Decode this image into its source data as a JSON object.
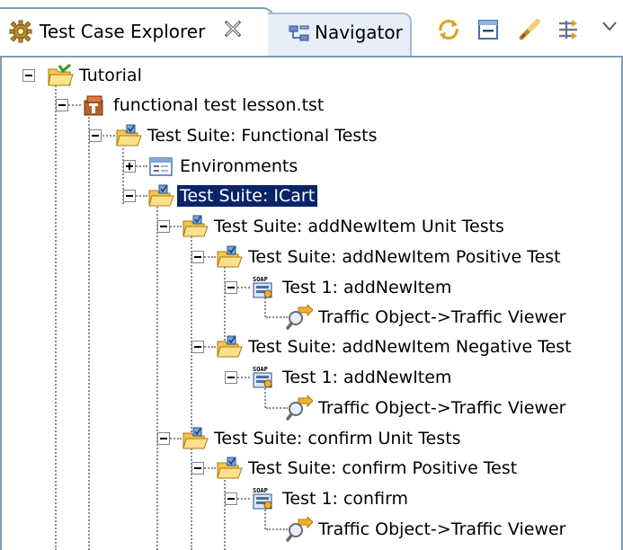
{
  "tabs": {
    "active_label": "Test Case Explorer",
    "inactive_label": "Navigator"
  },
  "toolbar": {
    "buttons": [
      "sync-icon",
      "collapse-all-icon",
      "link-editor-icon",
      "filter-icon"
    ],
    "view_menu": "chevron-down-icon"
  },
  "tree": {
    "nodes": [
      {
        "label": "Tutorial",
        "icon": "project-folder-icon",
        "expander": "minus"
      },
      {
        "label": "functional test lesson.tst",
        "icon": "test-file-icon",
        "expander": "minus"
      },
      {
        "label": "Test Suite: Functional Tests",
        "icon": "test-suite-folder-icon",
        "expander": "minus"
      },
      {
        "label": "Environments",
        "icon": "environments-icon",
        "expander": "plus"
      },
      {
        "label": "Test Suite: ICart",
        "icon": "test-suite-folder-icon",
        "expander": "minus",
        "selected": true
      },
      {
        "label": "Test Suite: addNewItem Unit Tests",
        "icon": "test-suite-folder-icon",
        "expander": "minus"
      },
      {
        "label": "Test Suite: addNewItem Positive Test",
        "icon": "test-suite-folder-icon",
        "expander": "minus"
      },
      {
        "label": "Test 1: addNewItem",
        "icon": "soap-test-icon",
        "expander": "minus"
      },
      {
        "label": "Traffic Object->Traffic Viewer",
        "icon": "traffic-viewer-icon",
        "expander": "none"
      },
      {
        "label": "Test Suite: addNewItem Negative Test",
        "icon": "test-suite-folder-icon",
        "expander": "minus"
      },
      {
        "label": "Test 1: addNewItem",
        "icon": "soap-test-icon",
        "expander": "minus"
      },
      {
        "label": "Traffic Object->Traffic Viewer",
        "icon": "traffic-viewer-icon",
        "expander": "none"
      },
      {
        "label": "Test Suite: confirm Unit Tests",
        "icon": "test-suite-folder-icon",
        "expander": "minus"
      },
      {
        "label": "Test Suite: confirm Positive Test",
        "icon": "test-suite-folder-icon",
        "expander": "minus"
      },
      {
        "label": "Test 1: confirm",
        "icon": "soap-test-icon",
        "expander": "minus"
      },
      {
        "label": "Traffic Object->Traffic Viewer",
        "icon": "traffic-viewer-icon",
        "expander": "none"
      }
    ]
  },
  "colors": {
    "selection": "#0a246a",
    "border": "#7f9db9",
    "folder": "#f4c64a"
  }
}
